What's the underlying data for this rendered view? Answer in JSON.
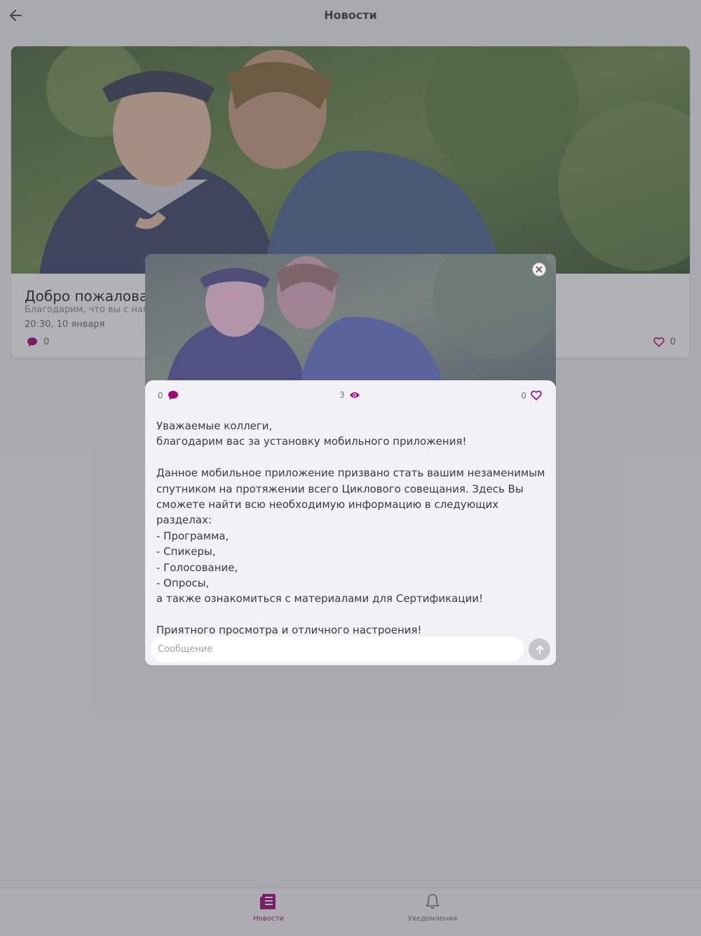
{
  "header": {
    "title": "Новости"
  },
  "card": {
    "title": "Добро пожаловать!",
    "subtitle": "Благодарим, что вы с нами",
    "date": "20:30, 10 января",
    "comments": "0",
    "likes": "0"
  },
  "modal": {
    "stats": {
      "comments": "0",
      "views": "3",
      "likes": "0"
    },
    "body": "Уважаемые коллеги,\nблагодарим вас за установку мобильного приложения!\n\nДанное мобильное приложение призвано стать вашим незаменимым спутником на протяжении всего Циклового совещания. Здесь Вы сможете найти всю необходимую информацию в следующих разделах:\n- Программа,\n- Спикеры,\n- Голосование,\n- Опросы,\nа также ознакомиться с материалами для Сертификации!\n\nПриятного просмотра и отличного настроения!",
    "input_placeholder": "Сообщение",
    "input_value": ""
  },
  "tabs": [
    {
      "label": "Новости",
      "icon": "news-icon",
      "active": true
    },
    {
      "label": "Уведомления",
      "icon": "bell-icon",
      "active": false
    }
  ],
  "colors": {
    "accent": "#a3007b",
    "overlay": "#6e60a8"
  }
}
